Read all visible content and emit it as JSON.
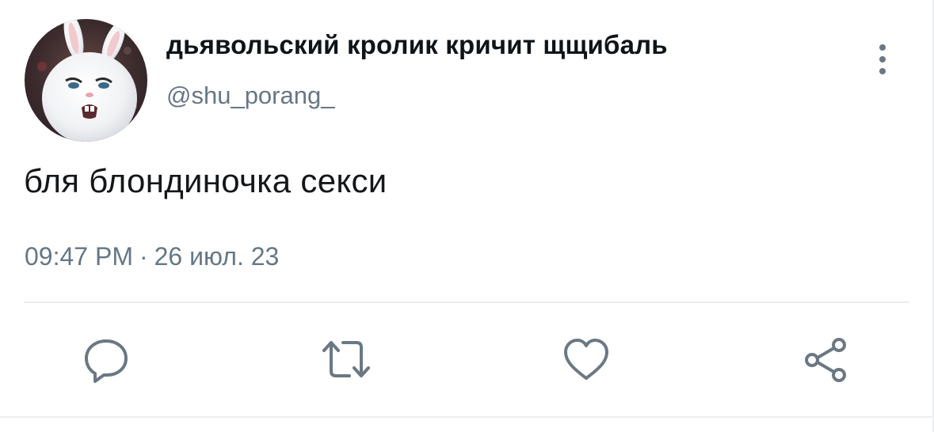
{
  "tweet": {
    "display_name": "дьявольский кролик кричит щщибаль",
    "handle": "@shu_porang_",
    "text": "бля блондиночка секси",
    "time": "09:47 PM",
    "separator": "·",
    "date": "26 июл. 23"
  },
  "avatar": {
    "depicts": "white-bunny-avatar"
  },
  "actions": [
    {
      "icon": "reply-icon"
    },
    {
      "icon": "retweet-icon"
    },
    {
      "icon": "like-icon"
    },
    {
      "icon": "share-icon"
    }
  ],
  "colors": {
    "text_primary": "#0f1419",
    "text_secondary": "#657786",
    "icon": "#6b7884",
    "divider": "#e9ecef"
  }
}
